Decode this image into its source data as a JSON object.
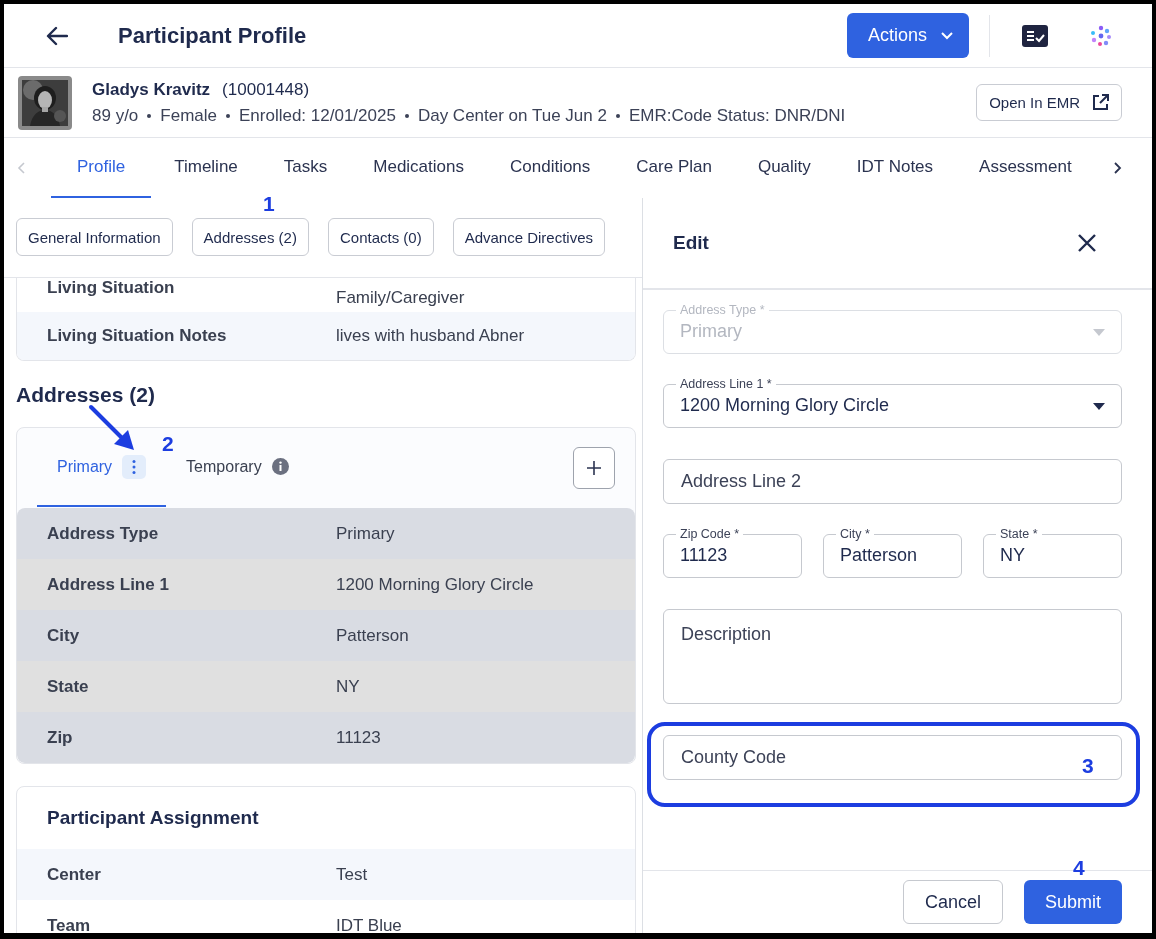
{
  "header": {
    "title": "Participant Profile",
    "actions_button": "Actions"
  },
  "participant": {
    "photo": {
      "kind": "picture"
    },
    "name": "Gladys Kravitz",
    "id": "(10001448)",
    "details": [
      "89 y/o",
      "Female",
      "Enrolled: 12/01/2025",
      "Day Center on Tue Jun 2",
      "EMR:Code Status: DNR/DNI"
    ],
    "open_button": "Open In EMR"
  },
  "tabs": [
    {
      "label": "Profile",
      "selected": true
    },
    {
      "label": "Timeline",
      "selected": false
    },
    {
      "label": "Tasks",
      "selected": false
    },
    {
      "label": "Medications",
      "selected": false
    },
    {
      "label": "Conditions",
      "selected": false
    },
    {
      "label": "Care Plan",
      "selected": false
    },
    {
      "label": "Quality",
      "selected": false
    },
    {
      "label": "IDT Notes",
      "selected": false
    },
    {
      "label": "Assessment",
      "selected": false
    }
  ],
  "section_chips": [
    "General Information",
    "Addresses (2)",
    "Contacts (0)",
    "Advance Directives"
  ],
  "living_rows": [
    {
      "label": "Living Situation",
      "value": "Family/Caregiver"
    },
    {
      "label": "Living Situation Notes",
      "value": "lives with husband Abner"
    }
  ],
  "addresses": {
    "title": "Addresses (2)",
    "tabs": [
      {
        "label": "Primary",
        "selected": true,
        "kind": "menu"
      },
      {
        "label": "Temporary",
        "selected": false,
        "kind": "info"
      }
    ],
    "rows": [
      {
        "label": "Address Type",
        "value": "Primary"
      },
      {
        "label": "Address Line 1",
        "value": "1200 Morning Glory Circle"
      },
      {
        "label": "City",
        "value": "Patterson"
      },
      {
        "label": "State",
        "value": "NY"
      },
      {
        "label": "Zip",
        "value": "11123"
      }
    ]
  },
  "assignment": {
    "title": "Participant Assignment",
    "rows": [
      {
        "label": "Center",
        "value": "Test"
      },
      {
        "label": "Team",
        "value": "IDT Blue"
      }
    ]
  },
  "edit_panel": {
    "title": "Edit",
    "field_rows": [
      [
        {
          "kind": "select",
          "label": "Address Type *",
          "value": "Primary",
          "disabled": true
        }
      ],
      [
        {
          "kind": "select",
          "label": "Address Line 1 *",
          "value": "1200 Morning Glory Circle",
          "disabled": false
        }
      ],
      [
        {
          "kind": "text",
          "placeholder": "Address Line 2"
        }
      ],
      [
        {
          "kind": "labeled",
          "label": "Zip Code *",
          "value": "11123"
        },
        {
          "kind": "labeled",
          "label": "City *",
          "value": "Patterson"
        },
        {
          "kind": "labeled",
          "label": "State *",
          "value": "NY"
        }
      ],
      [
        {
          "kind": "textarea",
          "placeholder": "Description"
        }
      ],
      [
        {
          "kind": "text",
          "placeholder": "County Code"
        }
      ]
    ],
    "cancel_button": "Cancel",
    "submit_button": "Submit"
  },
  "annotations": [
    {
      "label": "1",
      "kind": "number"
    },
    {
      "label": "2",
      "kind": "arrow"
    },
    {
      "label": "3",
      "kind": "frame"
    },
    {
      "label": "4",
      "kind": "number"
    }
  ]
}
